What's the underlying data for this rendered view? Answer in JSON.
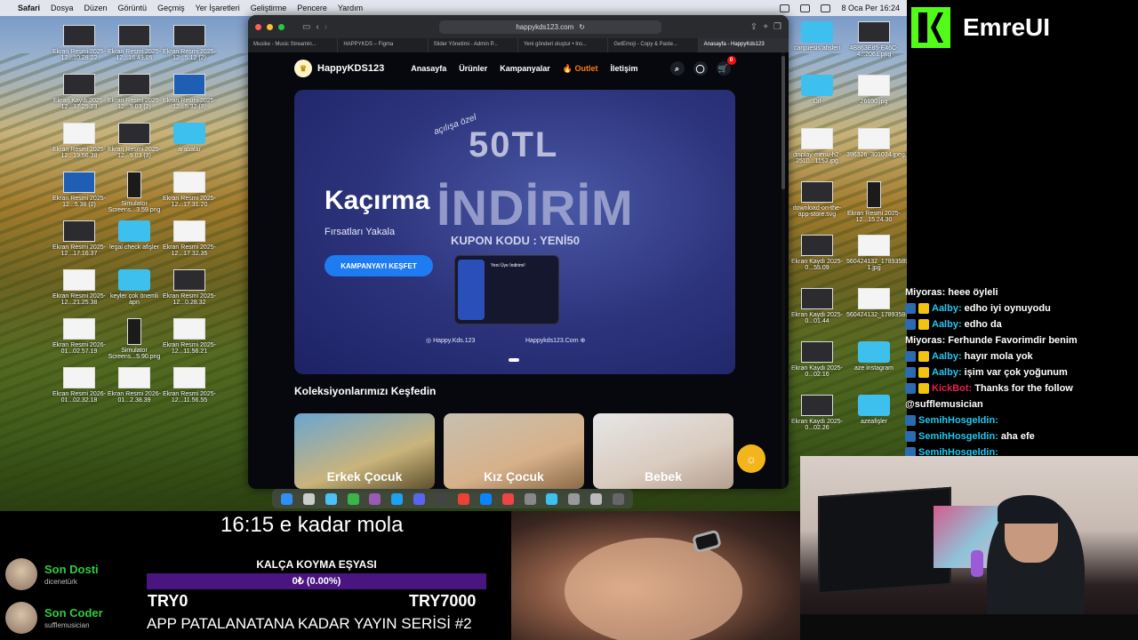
{
  "menubar": {
    "app": "Safari",
    "items": [
      "Dosya",
      "Düzen",
      "Görüntü",
      "Geçmiş",
      "Yer İşaretleri",
      "Geliştirme",
      "Pencere",
      "Yardım"
    ],
    "clock": "8 Oca Per  16:24"
  },
  "desktop_icons_left": [
    {
      "label": "Ekran Resmi 2025-12...10.28.22",
      "type": "dark"
    },
    {
      "label": "Ekran Resmi 2025-12...16.49.05",
      "type": "dark"
    },
    {
      "label": "Ekran Resmi 2025-12...5.12 (2)",
      "type": "dark"
    },
    {
      "label": "Ekran Kaydı 2025-12...17.25.23",
      "type": "dark"
    },
    {
      "label": "Ekran Resmi 2025-12...9.03 (2)",
      "type": "dark"
    },
    {
      "label": "Ekran Resmi 2025-12...5.32 (3)",
      "type": "blue"
    },
    {
      "label": "Ekran Resmi 2025-12...19.56.38",
      "type": "white"
    },
    {
      "label": "Ekran Resmi 2025-12...9.03 (3)",
      "type": "dark"
    },
    {
      "label": "arabalar",
      "type": "folder"
    },
    {
      "label": "Ekran Resmi 2025-12...5.36 (2)",
      "type": "blue"
    },
    {
      "label": "Simulator Screens...3.59.png",
      "type": "tall"
    },
    {
      "label": "Ekran Resmi 2025-12...17.31.20",
      "type": "white"
    },
    {
      "label": "Ekran Resmi 2025-12...17.16.37",
      "type": "dark"
    },
    {
      "label": "legal check afişler",
      "type": "folder"
    },
    {
      "label": "Ekran Resmi 2025-12...17.32.35",
      "type": "white"
    },
    {
      "label": "Ekran Resmi 2025-12...21.25.38",
      "type": "white"
    },
    {
      "label": "keyler çok önemli apn",
      "type": "folder"
    },
    {
      "label": "Ekran Resmi 2025-12...0.28.32",
      "type": "dark"
    },
    {
      "label": "Ekran Resmi 2026-01...02.57.19",
      "type": "white"
    },
    {
      "label": "Simulator Screens...5.90.png",
      "type": "tall"
    },
    {
      "label": "Ekran Resmi 2025-12...11.56.21",
      "type": "white"
    },
    {
      "label": "Ekran Resmi 2026-01...02.32.18",
      "type": "white"
    },
    {
      "label": "Ekran Resmi 2026-01...2.38.39",
      "type": "white"
    },
    {
      "label": "Ekran Resmi 2025-12...11.56.55",
      "type": "white"
    }
  ],
  "desktop_icons_right": [
    {
      "label": "carguesis afişleri",
      "type": "folder"
    },
    {
      "label": "4B863E85-E46C-4...2061.png",
      "type": "dark"
    },
    {
      "label": "Dif",
      "type": "folder"
    },
    {
      "label": "26690.jpg",
      "type": "white"
    },
    {
      "label": "display-menu-h2-2510...1152.jpg",
      "type": "white"
    },
    {
      "label": "396326_301034.jpeg.webp",
      "type": "white"
    },
    {
      "label": "download-on-the-app-store.svg",
      "type": "dark"
    },
    {
      "label": "Ekran Resmi 2025-12...15.24.30",
      "type": "tall"
    },
    {
      "label": "Ekran Kaydı 2025-0...55.09",
      "type": "dark"
    },
    {
      "label": "560424132_17893589952...5_n-1.jpg",
      "type": "white"
    },
    {
      "label": "Ekran Kaydı 2025-0...01.44",
      "type": "dark"
    },
    {
      "label": "560424132_17893589952...65_n.jpg",
      "type": "white"
    },
    {
      "label": "Ekran Kaydı 2025-0...02.16",
      "type": "dark"
    },
    {
      "label": "aze instagram",
      "type": "folder"
    },
    {
      "label": "Ekran Kaydı 2025-0...02.26",
      "type": "dark"
    },
    {
      "label": "azeafişler",
      "type": "folder"
    }
  ],
  "browser": {
    "url": "happykds123.com",
    "tabs": [
      "Musike - Music Streamin...",
      "HAPPYKDS – Figma",
      "Slider Yönetimi - Admin P...",
      "Yeni gönderi oluştur • Ins...",
      "GetEmoji - Copy & Paste...",
      "Anasayfa - HappyKds123"
    ],
    "site": {
      "logo": "HappyKDS123",
      "nav": [
        "Anasayfa",
        "Ürünler",
        "Kampanyalar",
        "Outlet",
        "İletişim"
      ],
      "cart_count": "0",
      "hero": {
        "special": "açılışa özel",
        "amount": "50TL",
        "discount": "İNDİRİM",
        "coupon": "KUPON KODU : YENİ50",
        "headline": "Kaçırma",
        "sub": "Fırsatları Yakala",
        "cta": "KAMPANYAYI KEŞFET",
        "instagram": "Happy.Kds.123",
        "website": "Happykds123.Com",
        "card_text": "Yeni Üye İndirimi!"
      },
      "collections_title": "Koleksiyonlarımızı Keşfedin",
      "collections": [
        "Erkek Çocuk",
        "Kız Çocuk",
        "Bebek"
      ]
    }
  },
  "overlay": {
    "brand": "EmreUI",
    "chat": [
      {
        "user": "Miyoras",
        "text": "heee öyleli",
        "color": "#ffffff",
        "badges": 0
      },
      {
        "user": "Aalby",
        "text": "edho iyi oynuyodu",
        "color": "#1ec9f0",
        "badges": 2
      },
      {
        "user": "Aalby",
        "text": "edho da",
        "color": "#1ec9f0",
        "badges": 2
      },
      {
        "user": "Miyoras",
        "text": "Ferhunde Favorimdir benim",
        "color": "#ffffff",
        "badges": 0
      },
      {
        "user": "Aalby",
        "text": "hayır mola yok",
        "color": "#1ec9f0",
        "badges": 2
      },
      {
        "user": "Aalby",
        "text": "işim var çok yoğunum",
        "color": "#1ec9f0",
        "badges": 2
      },
      {
        "user": "KickBot",
        "text": "Thanks for the follow",
        "color": "#e3214c",
        "badges": 2
      },
      {
        "user": "",
        "text": "@sufflemusician",
        "color": "#ffffff",
        "badges": 0
      },
      {
        "user": "SemihHosgeldin",
        "text": "",
        "color": "#1ec9f0",
        "badges": 1
      },
      {
        "user": "SemihHosgeldin",
        "text": "aha efe",
        "color": "#1ec9f0",
        "badges": 1
      },
      {
        "user": "SemihHosgeldin",
        "text": "",
        "color": "#1ec9f0",
        "badges": 1
      }
    ],
    "break_text": "16:15 e kadar mola",
    "goal": {
      "title": "KALÇA KOYMA EŞYASI",
      "progress_text": "0₺ (0.00%)",
      "progress": 0.0,
      "min": "TRY0",
      "max": "TRY7000"
    },
    "series_title": "APP PATALANATANA KADAR YAYIN SERİSİ #2",
    "supporters": [
      {
        "label": "Son Dosti",
        "who": "dicenetürk"
      },
      {
        "label": "Son Coder",
        "who": "sufflemusician"
      }
    ]
  },
  "colors": {
    "kick_green": "#53fc18",
    "cta_blue": "#1e7cf2",
    "outlet_orange": "#ff7a18",
    "goal_purple": "#a23cf0"
  }
}
